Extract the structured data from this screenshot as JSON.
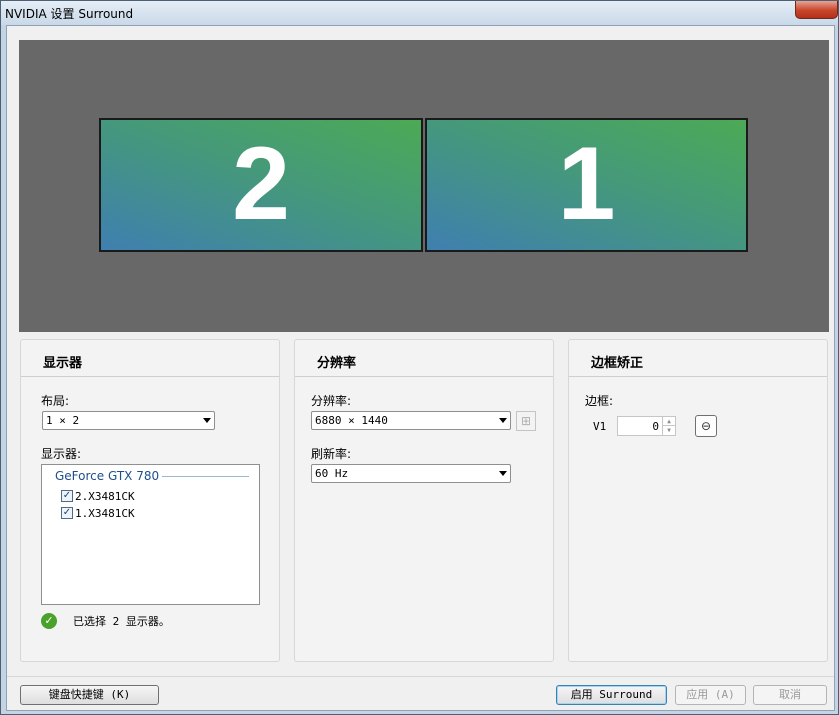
{
  "window": {
    "title": "NVIDIA 设置 Surround"
  },
  "preview": {
    "monitors": [
      {
        "number": "2"
      },
      {
        "number": "1"
      }
    ]
  },
  "displays_panel": {
    "title": "显示器",
    "layout_label": "布局:",
    "layout_value": "1 × 2",
    "displays_label": "显示器:",
    "gpu_group": "GeForce GTX 780",
    "items": [
      {
        "label": "2.X3481CK",
        "checked": true
      },
      {
        "label": "1.X3481CK",
        "checked": true
      }
    ],
    "status": "已选择 2 显示器。",
    "status_icon": "check-circle-icon"
  },
  "resolution_panel": {
    "title": "分辨率",
    "resolution_label": "分辨率:",
    "resolution_value": "6880 × 1440",
    "refresh_label": "刷新率:",
    "refresh_value": "60 Hz",
    "add_icon": "add-resolution-icon"
  },
  "bezel_panel": {
    "title": "边框矫正",
    "bezel_label": "边框:",
    "v1_label": "V1",
    "v1_value": "0",
    "link_icon": "link-icon"
  },
  "footer": {
    "keyboard_shortcuts": "键盘快捷键 (K)",
    "enable_surround": "启用 Surround",
    "apply": "应用 (A)",
    "cancel": "取消"
  },
  "colors": {
    "preview_bg": "#686868",
    "monitor_gradient_start": "#4caa55",
    "monitor_gradient_end": "#3f7fb0",
    "group_label": "#1e4e8c",
    "ok_green": "#4aa12c"
  }
}
